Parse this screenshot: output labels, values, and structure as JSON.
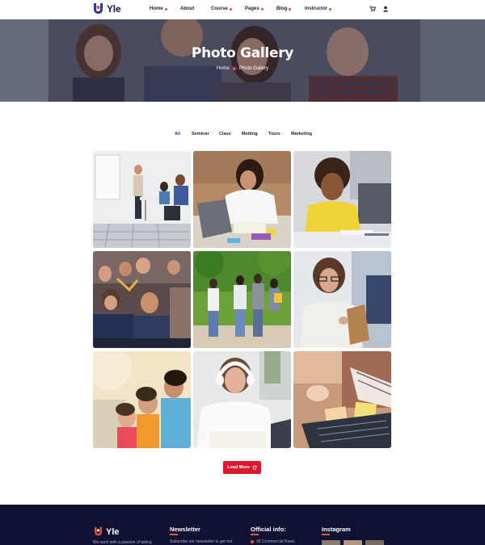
{
  "brand": {
    "name": "Yle",
    "accent": "#e8542a",
    "primary": "#2b3aa8",
    "dark": "#0e1333"
  },
  "nav": {
    "items": [
      {
        "label": "Home",
        "has_dropdown": true
      },
      {
        "label": "About",
        "has_dropdown": false
      },
      {
        "label": "Course",
        "has_dropdown": true
      },
      {
        "label": "Pages",
        "has_dropdown": true
      },
      {
        "label": "Blog",
        "has_dropdown": true
      },
      {
        "label": "Instructor",
        "has_dropdown": true
      }
    ],
    "icons": [
      "cart-icon",
      "user-icon"
    ]
  },
  "hero": {
    "title": "Photo Gallery",
    "breadcrumb": [
      "Home",
      "Photo Gallery"
    ]
  },
  "filters": {
    "active": "All",
    "items": [
      "All",
      "Seminar",
      "Class",
      "Metting",
      "Tours",
      "Marketing"
    ]
  },
  "gallery": {
    "photos": [
      "seminar-presentation-photo",
      "student-studying-laptop-photo",
      "smiling-student-desk-photo",
      "group-students-laughing-photo",
      "students-walking-outdoors-photo",
      "student-holding-notebook-photo",
      "children-looking-up-photo",
      "woman-headphones-writing-photo",
      "hands-laptop-sticky-notes-photo"
    ]
  },
  "load_more": {
    "label": "Load More",
    "icon": "refresh-icon"
  },
  "footer": {
    "logo": "Yle",
    "tagline": "We work with a passion of taking",
    "newsletter": {
      "heading": "Newsletter",
      "text": "Subscribe our newsletter to get our"
    },
    "official": {
      "heading": "Official info:",
      "text": "30 Commercial Road,"
    },
    "instagram": {
      "heading": "Instagram"
    }
  }
}
